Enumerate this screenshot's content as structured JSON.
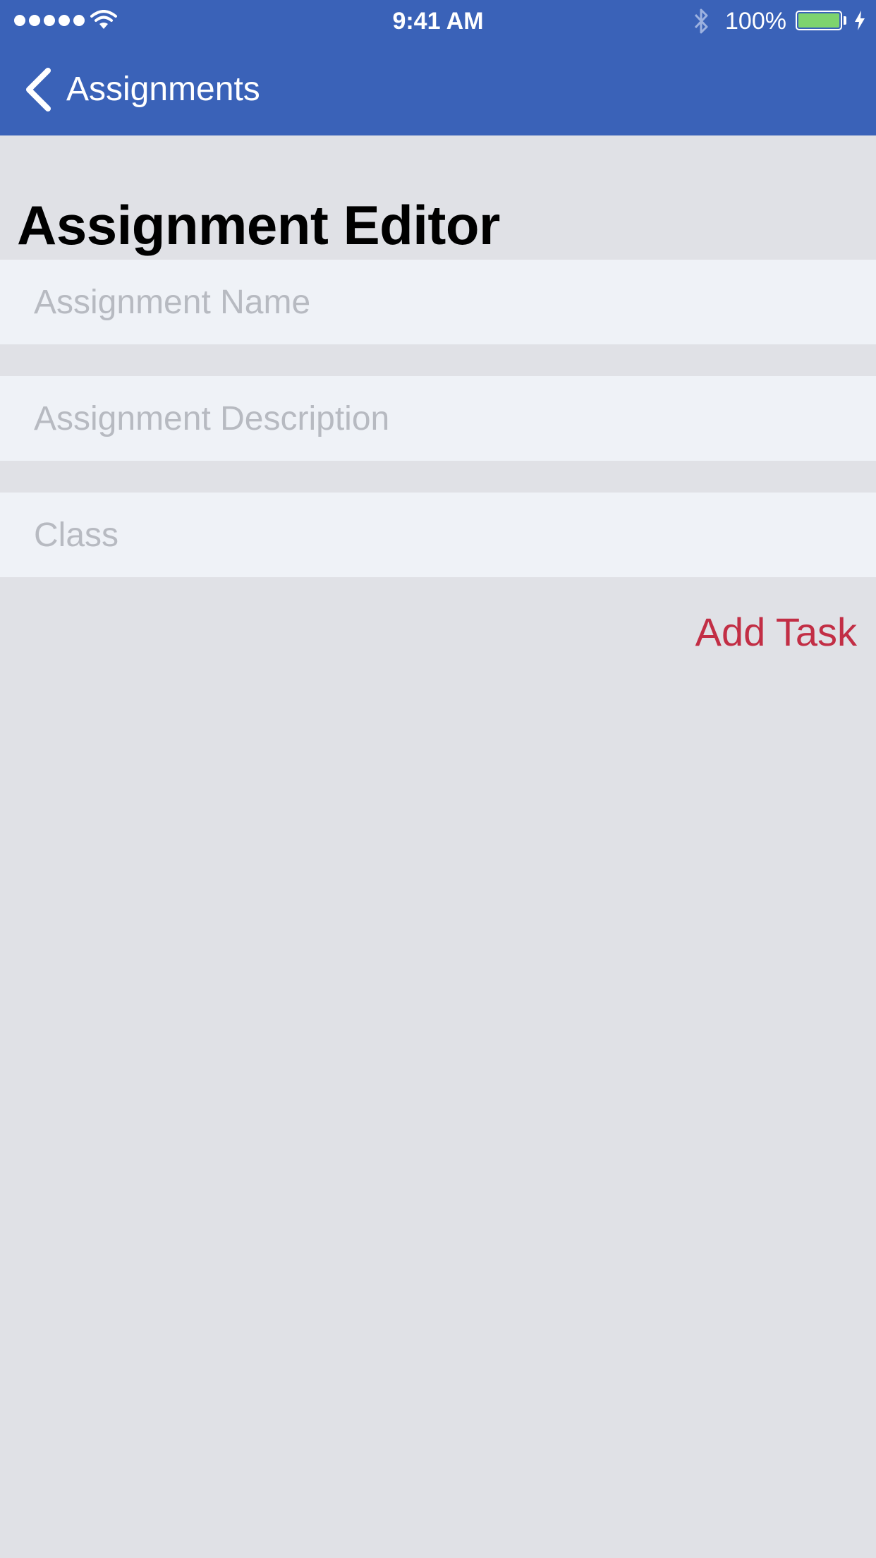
{
  "status_bar": {
    "time": "9:41 AM",
    "battery_percent": "100%",
    "battery_level": 1.0,
    "signal_bars": 5,
    "icons": [
      "signal-dots-icon",
      "wifi-icon",
      "bluetooth-icon",
      "battery-icon",
      "charging-bolt-icon"
    ]
  },
  "nav": {
    "back_label": "Assignments",
    "back_icon": "chevron-left-icon"
  },
  "page": {
    "title": "Assignment Editor"
  },
  "form": {
    "name_placeholder": "Assignment Name",
    "name_value": "",
    "description_placeholder": "Assignment Description",
    "description_value": "",
    "class_placeholder": "Class",
    "class_value": ""
  },
  "actions": {
    "add_task_label": "Add Task"
  },
  "colors": {
    "nav_background": "#3A62B8",
    "page_background": "#E0E1E6",
    "field_background": "#EFF2F7",
    "placeholder": "#B7BAC1",
    "accent": "#C22E45",
    "battery_fill": "#7ED36E"
  }
}
